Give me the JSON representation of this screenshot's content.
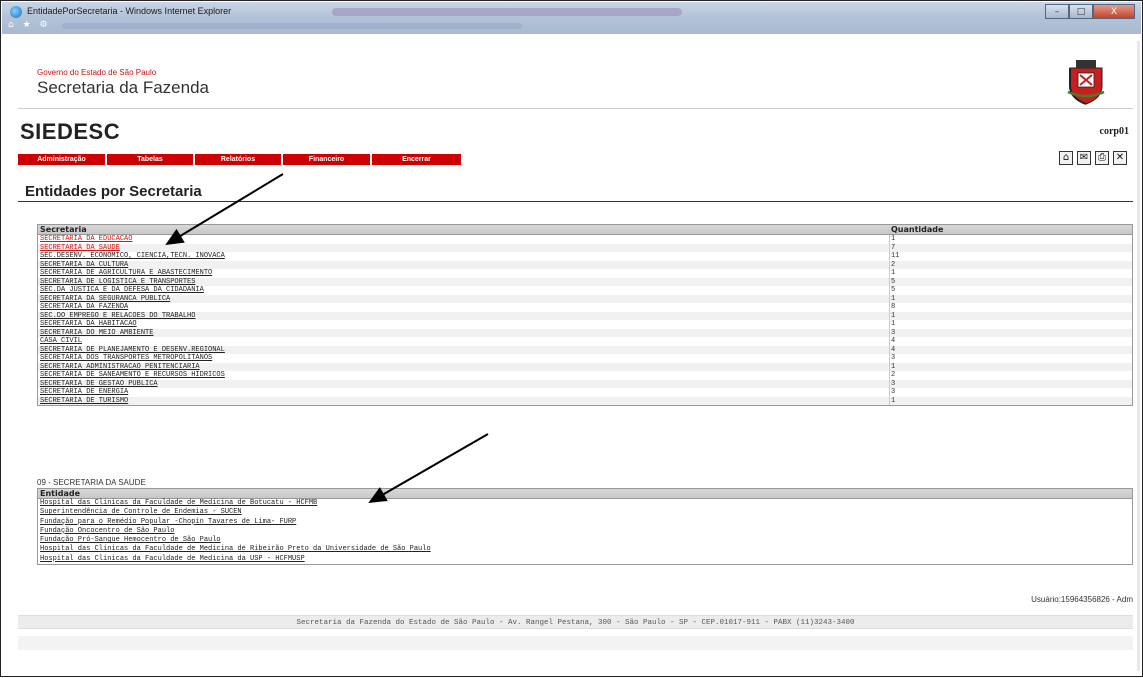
{
  "window": {
    "title": "EntidadePorSecretaria - Windows Internet Explorer",
    "min_glyph": "–",
    "max_glyph": "□",
    "close_glyph": "X",
    "nav_glyphs": "⌂ ★ ⚙"
  },
  "header": {
    "gov_label": "Governo do Estado de São Paulo",
    "org_label": "Secretaria da Fazenda",
    "app_name": "SIEDESC",
    "user_code": "corp01"
  },
  "menu": [
    {
      "label": "Administração"
    },
    {
      "label": "Tabelas"
    },
    {
      "label": "Relatórios"
    },
    {
      "label": "Financeiro"
    },
    {
      "label": "Encerrar"
    }
  ],
  "tool_icons": [
    {
      "icon": "home-icon",
      "glyph": "⌂"
    },
    {
      "icon": "mail-icon",
      "glyph": "✉"
    },
    {
      "icon": "print-icon",
      "glyph": "⎙"
    },
    {
      "icon": "close-icon",
      "glyph": "✕"
    }
  ],
  "page_title": "Entidades por Secretaria",
  "secretarias_table": {
    "headers": {
      "secretaria": "Secretaria",
      "quantidade": "Quantidade"
    },
    "rows": [
      {
        "secretaria": "SECRETARIA DA EDUCACAO",
        "quantidade": "1",
        "red": true
      },
      {
        "secretaria": "SECRETARIA DA SAUDE",
        "quantidade": "7",
        "red": true
      },
      {
        "secretaria": "SEC.DESENV. ECONOMICO, CIENCIA,TECN. INOVACA",
        "quantidade": "11"
      },
      {
        "secretaria": "SECRETARIA DA CULTURA",
        "quantidade": "2"
      },
      {
        "secretaria": "SECRETARIA DE AGRICULTURA E ABASTECIMENTO",
        "quantidade": "1"
      },
      {
        "secretaria": "SECRETARIA DE LOGISTICA E TRANSPORTES",
        "quantidade": "5"
      },
      {
        "secretaria": "SEC.DA JUSTICA E DA DEFESA DA CIDADANIA",
        "quantidade": "5"
      },
      {
        "secretaria": "SECRETARIA DA SEGURANCA PUBLICA",
        "quantidade": "1"
      },
      {
        "secretaria": "SECRETARIA DA FAZENDA",
        "quantidade": "8"
      },
      {
        "secretaria": "SEC.DO EMPREGO E RELACOES DO TRABALHO",
        "quantidade": "1"
      },
      {
        "secretaria": "SECRETARIA DA HABITACAO",
        "quantidade": "1"
      },
      {
        "secretaria": "SECRETARIA DO MEIO AMBIENTE",
        "quantidade": "3"
      },
      {
        "secretaria": "CASA CIVIL",
        "quantidade": "4"
      },
      {
        "secretaria": "SECRETARIA DE PLANEJAMENTO E DESENV.REGIONAL",
        "quantidade": "4"
      },
      {
        "secretaria": "SECRETARIA DOS TRANSPORTES METROPOLITANOS",
        "quantidade": "3"
      },
      {
        "secretaria": "SECRETARIA ADMINISTRACAO PENITENCIARIA",
        "quantidade": "1"
      },
      {
        "secretaria": "SECRETARIA DE SANEAMENTO E RECURSOS HIDRICOS",
        "quantidade": "2"
      },
      {
        "secretaria": "SECRETARIA DE GESTAO PUBLICA",
        "quantidade": "3"
      },
      {
        "secretaria": "SECRETARIA DE ENERGIA",
        "quantidade": "3"
      },
      {
        "secretaria": "SECRETARIA DE TURISMO",
        "quantidade": "1"
      }
    ]
  },
  "selected_secretaria": "09 - SECRETARIA DA SAUDE",
  "entidades_table": {
    "header": "Entidade",
    "rows": [
      "Hospital das Clínicas da Faculdade de Medicina de Botucatu - HCFMB",
      "Superintendência de Controle de Endemias - SUCEN",
      "Fundação para o Remédio Popular -Chopin Tavares de Lima- FURP",
      "Fundação Oncocentro de São Paulo",
      "Fundação Pró-Sangue Hemocentro de São Paulo",
      "Hospital das Clínicas da Faculdade de Medicina de Ribeirão Preto da Universidade de São Paulo",
      "Hospital das Clínicas da Faculdade de Medicina da USP - HCFMUSP"
    ]
  },
  "usuario": "Usuário:15964356826 - Adm",
  "footer": "Secretaria da Fazenda do Estado de São Paulo - Av. Rangel Pestana, 300 - São Paulo - SP - CEP.01017-911 - PABX (11)3243-3400"
}
